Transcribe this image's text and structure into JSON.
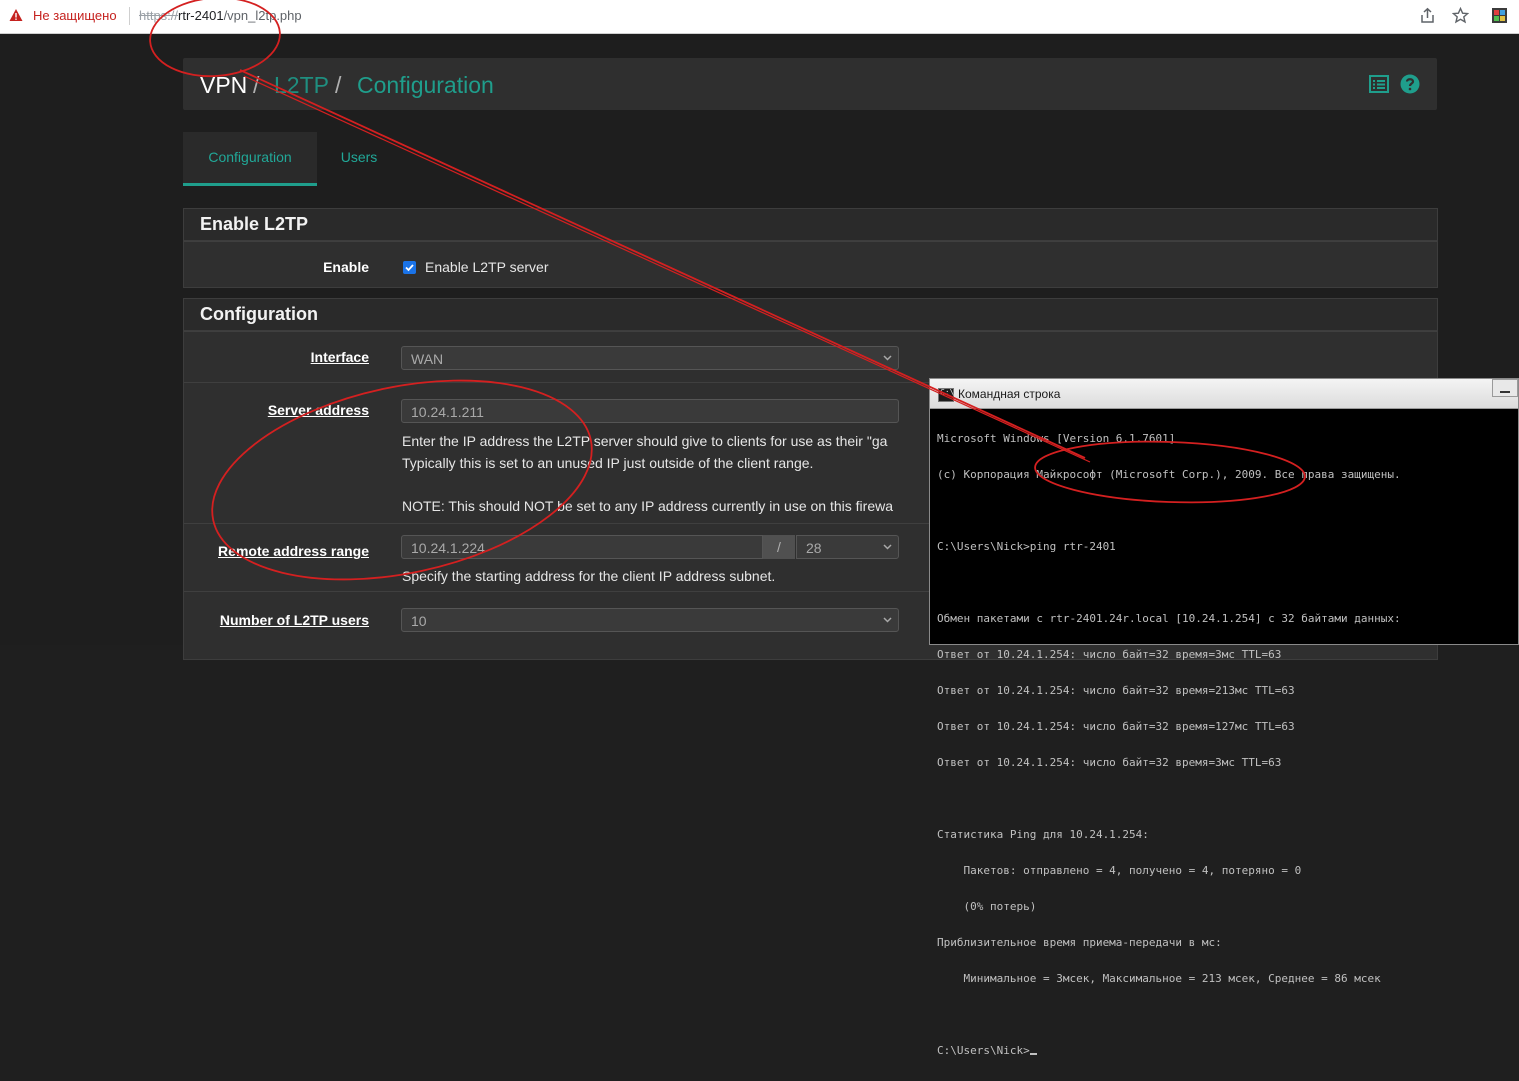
{
  "browser": {
    "security_text": "Не защищено",
    "url_scheme": "https://",
    "url_host": "rtr-2401",
    "url_path": "/vpn_l2tp.php"
  },
  "breadcrumb": {
    "root": "VPN",
    "sep": "/",
    "section": "L2TP",
    "page": "Configuration"
  },
  "tabs": [
    {
      "label": "Configuration",
      "active": true
    },
    {
      "label": "Users",
      "active": false
    }
  ],
  "enable_panel": {
    "title": "Enable L2TP",
    "enable_label": "Enable",
    "enable_checkbox_label": "Enable L2TP server",
    "enabled": true
  },
  "config_panel": {
    "title": "Configuration",
    "interface_label": "Interface",
    "interface_value": "WAN",
    "server_address_label": "Server address",
    "server_address_value": "10.24.1.211",
    "server_help_1": "Enter the IP address the L2TP server should give to clients for use as their \"ga",
    "server_help_2": "Typically this is set to an unused IP just outside of the client range.",
    "server_help_note": "NOTE: This should NOT be set to any IP address currently in use on this firewa",
    "remote_range_label": "Remote address range",
    "remote_range_value": "10.24.1.224",
    "cidr_sep": "/",
    "cidr_value": "28",
    "remote_help": "Specify the starting address for the client IP address subnet.",
    "users_label": "Number of L2TP users",
    "users_value": "10"
  },
  "cmd": {
    "title": "Командная строка",
    "lines": [
      "Microsoft Windows [Version 6.1.7601]",
      "(c) Корпорация Майкрософт (Microsoft Corp.), 2009. Все права защищены.",
      "",
      "C:\\Users\\Nick>ping rtr-2401",
      "",
      "Обмен пакетами с rtr-2401.24r.local [10.24.1.254] с 32 байтами данных:",
      "Ответ от 10.24.1.254: число байт=32 время=3мс TTL=63",
      "Ответ от 10.24.1.254: число байт=32 время=213мс TTL=63",
      "Ответ от 10.24.1.254: число байт=32 время=127мс TTL=63",
      "Ответ от 10.24.1.254: число байт=32 время=3мс TTL=63",
      "",
      "Статистика Ping для 10.24.1.254:",
      "    Пакетов: отправлено = 4, получено = 4, потеряно = 0",
      "    (0% потерь)",
      "Приблизительное время приема-передачи в мс:",
      "    Минимальное = 3мсек, Максимальное = 213 мсек, Среднее = 86 мсек",
      "",
      "C:\\Users\\Nick>"
    ]
  },
  "colors": {
    "accent": "#1f9e8c",
    "annotation": "#d42020"
  }
}
